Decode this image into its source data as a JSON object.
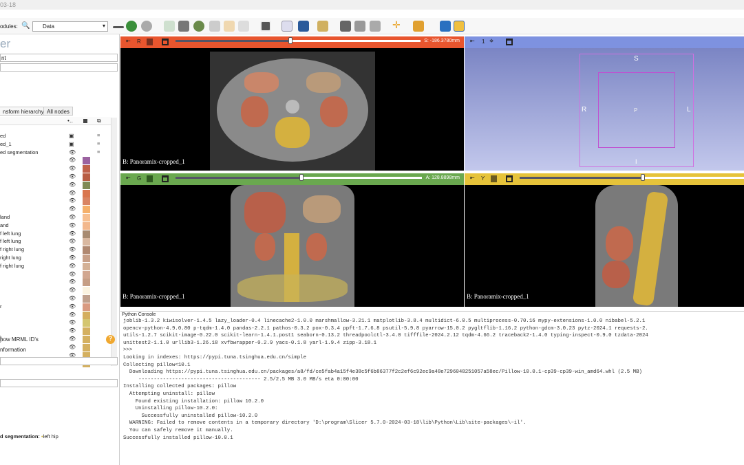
{
  "titlebar": {
    "text": "03-18"
  },
  "toolbar": {
    "modules_label": "odules:",
    "module_selected": "Data"
  },
  "left": {
    "title": "er",
    "field1": "nt",
    "tabs": [
      "nsform hierarchy",
      "All nodes"
    ],
    "nodes": [
      {
        "name": "ed",
        "type": "volume"
      },
      {
        "name": "ed_1",
        "type": "volume"
      },
      {
        "name": "ed segmentation",
        "type": "segmentation"
      }
    ],
    "segments": [
      {
        "name": "",
        "color": "#9b62a0"
      },
      {
        "name": "",
        "color": "#c0614a"
      },
      {
        "name": "",
        "color": "#b95d43"
      },
      {
        "name": "",
        "color": "#7f8b55"
      },
      {
        "name": "",
        "color": "#d9764f"
      },
      {
        "name": "",
        "color": "#d98463"
      },
      {
        "name": "",
        "color": "#f5b06a"
      },
      {
        "name": "land",
        "color": "#f7bf90"
      },
      {
        "name": "and",
        "color": "#f3b88d"
      },
      {
        "name": "f left lung",
        "color": "#a88b71"
      },
      {
        "name": "f left lung",
        "color": "#d9b8a0"
      },
      {
        "name": "f right lung",
        "color": "#b08870"
      },
      {
        "name": "right lung",
        "color": "#c8a088"
      },
      {
        "name": "f right lung",
        "color": "#d4b196"
      },
      {
        "name": "",
        "color": "#d2a790"
      },
      {
        "name": "",
        "color": "#c69e85"
      },
      {
        "name": "",
        "color": "#fbf3e0"
      },
      {
        "name": "",
        "color": "#c0a08c"
      },
      {
        "name": "r",
        "color": "#d99a80"
      },
      {
        "name": "",
        "color": "#d4ae5e"
      },
      {
        "name": "",
        "color": "#d4c670"
      },
      {
        "name": "",
        "color": "#d4b060"
      },
      {
        "name": "",
        "color": "#d4b060"
      },
      {
        "name": "",
        "color": "#d4b060"
      },
      {
        "name": "",
        "color": "#d4b060"
      },
      {
        "name": "",
        "color": "#d4b060"
      }
    ],
    "show_mrml_ids": "how MRML ID's",
    "information": "nformation",
    "status": {
      "label": "d segmentation:",
      "value": "left hip"
    }
  },
  "views": {
    "red": {
      "name": "R",
      "offset": "S: -186.3780mm",
      "slider": 0.47,
      "label": "B: Panoramix-cropped_1",
      "color": "#e8552e"
    },
    "green": {
      "name": "G",
      "offset": "A: 128.8898mm",
      "slider": 0.51,
      "label": "B: Panoramix-cropped_1",
      "color": "#6aa84f"
    },
    "yellow": {
      "name": "Y",
      "offset": "",
      "slider": 0.55,
      "label": "B: Panoramix-cropped_1",
      "color": "#e6c33a"
    },
    "threed": {
      "name": "1",
      "orient": {
        "S": "S",
        "R": "R",
        "L": "L",
        "P": "P",
        "I": "I"
      },
      "color": "#7e92e0"
    }
  },
  "console": {
    "title": "Python Console",
    "lines": [
      "joblib-1.3.2 kiwisolver-1.4.5 lazy_loader-0.4 linecache2-1.0.0 marshmallow-3.21.1 matplotlib-3.8.4 multidict-6.0.5 multiprocess-0.70.16 mypy-extensions-1.0.0 nibabel-5.2.1",
      "opencv-python-4.9.0.80 p-tqdm-1.4.0 pandas-2.2.1 pathos-0.3.2 pox-0.3.4 ppft-1.7.6.8 psutil-5.9.8 pyarrow-15.0.2 pygltflib-1.16.2 python-gdcm-3.0.23 pytz-2024.1 requests-2.",
      "utils-1.2.7 scikit-image-0.22.0 scikit-learn-1.4.1.post1 seaborn-0.13.2 threadpoolctl-3.4.0 tifffile-2024.2.12 tqdm-4.66.2 traceback2-1.4.0 typing-inspect-0.9.0 tzdata-2024",
      "unittest2-1.1.0 urllib3-1.26.18 xvfbwrapper-0.2.9 yacs-0.1.8 yarl-1.9.4 zipp-3.18.1",
      ">>>",
      "Looking in indexes: https://pypi.tuna.tsinghua.edu.cn/simple",
      "Collecting pillow<10.1",
      "  Downloading https://pypi.tuna.tsinghua.edu.cn/packages/a8/fd/ce5fab4a15f4e38c5f6b86377f2c2ef6c92ec9a48e7296048251057a58ec/Pillow-10.0.1-cp39-cp39-win_amd64.whl (2.5 MB)",
      "     ---------------------------------------- 2.5/2.5 MB 3.0 MB/s eta 0:00:00",
      "Installing collected packages: pillow",
      "  Attempting uninstall: pillow",
      "    Found existing installation: pillow 10.2.0",
      "    Uninstalling pillow-10.2.0:",
      "      Successfully uninstalled pillow-10.2.0",
      "  WARNING: Failed to remove contents in a temporary directory 'D:\\program\\Slicer 5.7.0-2024-03-18\\lib\\Python\\Lib\\site-packages\\~il'.",
      "  You can safely remove it manually.",
      "Successfully installed pillow-10.0.1"
    ]
  }
}
